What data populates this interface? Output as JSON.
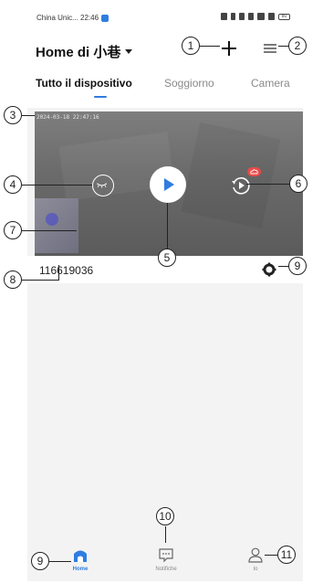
{
  "status_bar": {
    "carrier_time": "China Unic... 22:46",
    "battery": "80"
  },
  "header": {
    "title": "Home di 小巷",
    "add_icon": "plus-icon",
    "menu_icon": "menu-icon"
  },
  "tabs": [
    {
      "label": "Tutto il dispositivo",
      "active": true
    },
    {
      "label": "Soggiorno",
      "active": false
    },
    {
      "label": "Camera",
      "active": false
    }
  ],
  "device": {
    "timestamp": "2024-03-18 22:47:16",
    "name": "116619036",
    "privacy_icon": "closed-eye-icon",
    "play_icon": "play-icon",
    "playback_icon": "playback-icon",
    "cloud_icon": "cloud-icon",
    "settings_icon": "gear-icon"
  },
  "bottom_nav": [
    {
      "label": "Home",
      "icon": "home-icon",
      "active": true
    },
    {
      "label": "Notifiche",
      "icon": "message-icon",
      "active": false
    },
    {
      "label": "Io",
      "icon": "user-icon",
      "active": false
    }
  ],
  "callouts": [
    "1",
    "2",
    "3",
    "4",
    "5",
    "6",
    "7",
    "8",
    "9",
    "9",
    "10",
    "11"
  ],
  "colors": {
    "accent": "#2f7de1",
    "badge": "#e84a4a",
    "background": "#f3f3f3"
  }
}
